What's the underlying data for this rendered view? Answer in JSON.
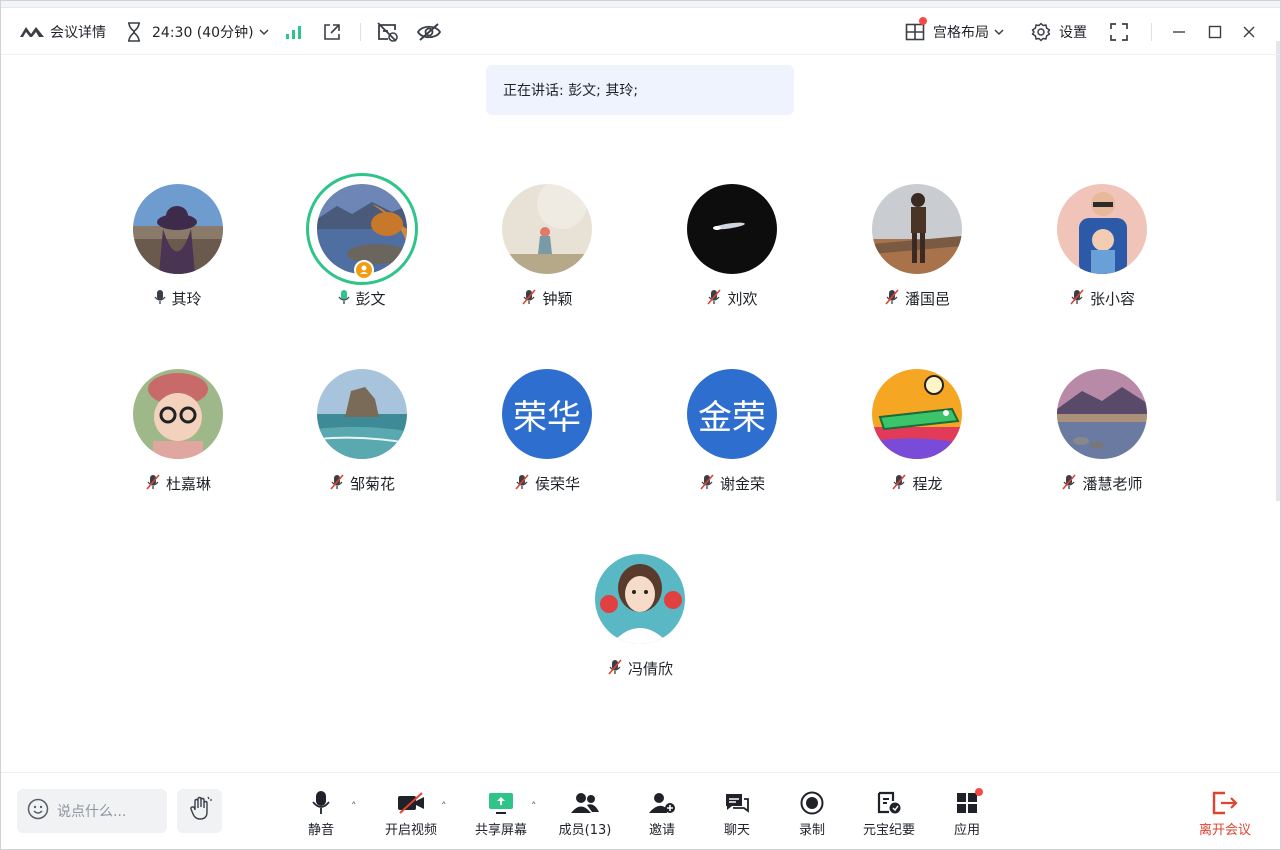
{
  "window": {
    "title_bar": {
      "logo_icon": "tencent-meeting-logo-icon",
      "details_label": "会议详情",
      "timer_text": "24:30 (40分钟)",
      "layout_label": "宫格布局",
      "settings_label": "设置"
    },
    "speaking_banner": "正在讲话: 彭文; 其玲;"
  },
  "participants": [
    {
      "name": "其玲",
      "mic": "speaking",
      "avatar": "photo"
    },
    {
      "name": "彭文",
      "mic": "speaking",
      "avatar": "photo",
      "active_speaker": true,
      "host": true
    },
    {
      "name": "钟颖",
      "mic": "muted",
      "avatar": "photo"
    },
    {
      "name": "刘欢",
      "mic": "muted",
      "avatar": "photo"
    },
    {
      "name": "潘国邑",
      "mic": "muted",
      "avatar": "photo"
    },
    {
      "name": "张小容",
      "mic": "muted",
      "avatar": "photo"
    },
    {
      "name": "杜嘉琳",
      "mic": "muted",
      "avatar": "photo"
    },
    {
      "name": "邹菊花",
      "mic": "muted",
      "avatar": "photo"
    },
    {
      "name": "侯荣华",
      "mic": "muted",
      "avatar": "text",
      "avatar_text": "荣华"
    },
    {
      "name": "谢金荣",
      "mic": "muted",
      "avatar": "text",
      "avatar_text": "金荣"
    },
    {
      "name": "程龙",
      "mic": "muted",
      "avatar": "photo"
    },
    {
      "name": "潘慧老师",
      "mic": "muted",
      "avatar": "photo"
    },
    {
      "name": "冯倩欣",
      "mic": "muted",
      "avatar": "photo"
    }
  ],
  "bottom_bar": {
    "chat_placeholder": "说点什么...",
    "tools": {
      "mute": "静音",
      "video": "开启视频",
      "share": "共享屏幕",
      "members": "成员(13)",
      "invite": "邀请",
      "chat": "聊天",
      "record": "录制",
      "summary": "元宝纪要",
      "apps": "应用",
      "leave": "离开会议"
    }
  },
  "colors": {
    "accent_green": "#2fc48a",
    "leave_red": "#e0432f",
    "text_avatar_blue": "#2d6ecf",
    "muted_red": "#e0432f",
    "banner_bg": "#eef3fd"
  }
}
